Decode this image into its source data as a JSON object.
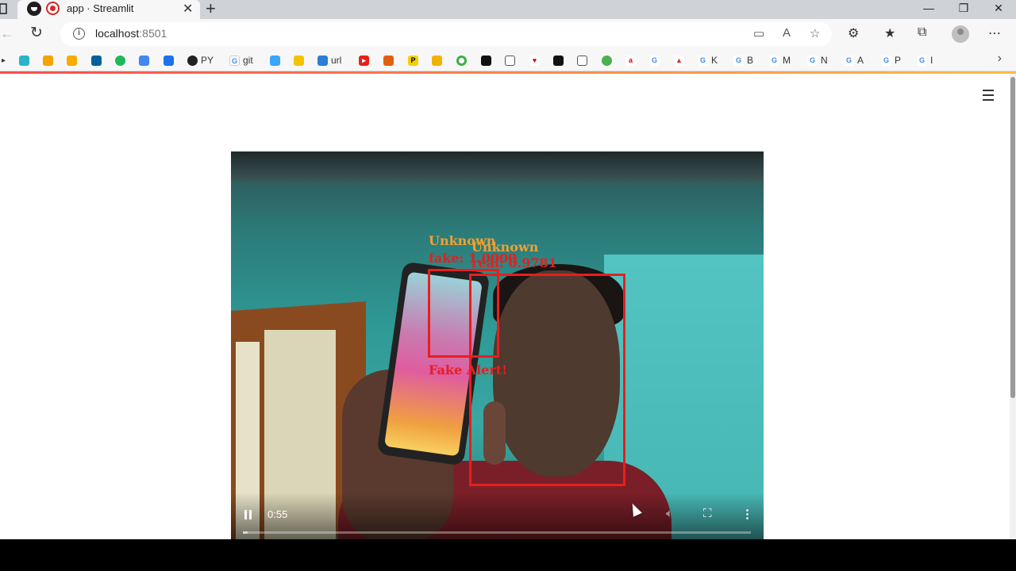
{
  "browser": {
    "tab": {
      "title": "app · Streamlit"
    },
    "address": {
      "host": "localhost",
      "port": ":8501"
    },
    "bookmarks": [
      {
        "label": "PY",
        "icon": "github-icon"
      },
      {
        "label": "git",
        "icon": "google-icon"
      },
      {
        "label": "url",
        "icon": "edge-icon"
      },
      {
        "label": "K",
        "icon": "google-icon"
      },
      {
        "label": "B",
        "icon": "google-icon"
      },
      {
        "label": "M",
        "icon": "google-icon"
      },
      {
        "label": "N",
        "icon": "google-icon"
      },
      {
        "label": "A",
        "icon": "google-icon"
      },
      {
        "label": "P",
        "icon": "google-icon"
      },
      {
        "label": "I",
        "icon": "google-icon"
      }
    ]
  },
  "video": {
    "time": "0:55",
    "progress": 0.01,
    "detections": [
      {
        "line1": "Unknown",
        "line2": "fake: 1.0000"
      },
      {
        "line1": "Unknown",
        "line2": "real: 0.9781"
      }
    ],
    "alert": "Fake Alert!"
  },
  "colors": {
    "accent": "#ff4b4b",
    "box": "#e81e1e",
    "label_orange": "#f0a030"
  }
}
